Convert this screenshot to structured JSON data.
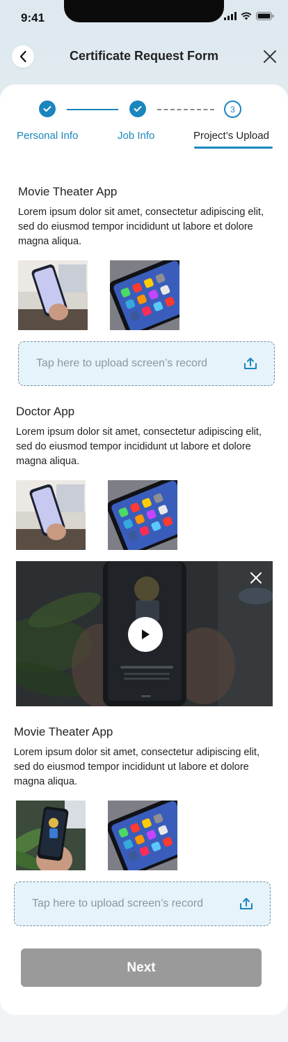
{
  "status_bar": {
    "time": "9:41"
  },
  "header": {
    "title": "Certificate Request Form",
    "back_icon": "chevron-left-icon",
    "close_icon": "close-icon"
  },
  "stepper": {
    "steps": [
      {
        "state": "completed"
      },
      {
        "state": "completed"
      },
      {
        "state": "current",
        "number": "3"
      }
    ]
  },
  "tabs": [
    {
      "label": "Personal Info",
      "active": false
    },
    {
      "label": "Job Info",
      "active": false
    },
    {
      "label": "Project’s Upload",
      "active": true
    }
  ],
  "projects": [
    {
      "title": "Movie Theater App",
      "description": "Lorem ipsum dolor sit amet, consectetur adipiscing elit, sed do eiusmod tempor incididunt ut labore et dolore magna aliqua.",
      "upload_label": "Tap here to upload screen’s record"
    },
    {
      "title": "Doctor App",
      "description": "Lorem ipsum dolor sit amet, consectetur adipiscing elit, sed do eiusmod tempor incididunt ut labore et dolore magna aliqua."
    },
    {
      "title": "Movie Theater App",
      "description": "Lorem ipsum dolor sit amet, consectetur adipiscing elit, sed do eiusmod tempor incididunt ut labore et dolore magna aliqua.",
      "upload_label": "Tap here to upload screen’s record"
    }
  ],
  "video": {
    "play_icon": "play-icon",
    "close_icon": "close-icon"
  },
  "next_button": {
    "label": "Next",
    "enabled": false
  },
  "colors": {
    "accent": "#1a86bd",
    "upload_bg": "#e6f3fa",
    "disabled_button": "#9a9a9a"
  }
}
